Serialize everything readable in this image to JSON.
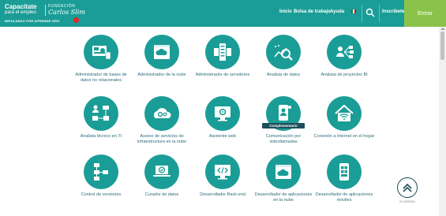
{
  "header": {
    "logo_line1": "Capacítate",
    "logo_line2": "para el empleo",
    "logo_fund_line1": "FUNDACIÓN",
    "logo_fund_line2": "Carlos Slim",
    "logo_sub": "IMPULSADO POR APRENDE.ORG",
    "nav": {
      "inicio": "Inicio",
      "bolsa": "Bolsa de trabajo",
      "ayuda": "Ayuda",
      "inscribete": "Inscríbete"
    },
    "entrar": "Entrar",
    "colors": {
      "bar": "#1a9d96",
      "entrar": "#8bc34a"
    }
  },
  "courses": [
    {
      "label": "Administrador de bases de datos no relacionales",
      "icon": "database-dashboard-icon"
    },
    {
      "label": "Administrador de la nube",
      "icon": "cloud-window-icon"
    },
    {
      "label": "Administrador de servidores",
      "icon": "server-icon"
    },
    {
      "label": "Analista de datos",
      "icon": "data-magnifier-icon"
    },
    {
      "label": "Analista de proyectos BI",
      "icon": "bi-network-icon"
    },
    {
      "label": "Analista técnico en TI",
      "icon": "flowchart-user-icon"
    },
    {
      "label": "Asesor de servicios de infraestructura en la nube",
      "icon": "cloud-gears-icon"
    },
    {
      "label": "Asistente web",
      "icon": "monitor-gear-icon"
    },
    {
      "label": "Comunicación por videollamadas",
      "icon": "video-call-icon",
      "badge": "Complementario"
    },
    {
      "label": "Conexión a internet en el hogar",
      "icon": "home-wifi-icon"
    },
    {
      "label": "Control de versiones",
      "icon": "version-tree-icon"
    },
    {
      "label": "Curador de datos",
      "icon": "laptop-check-icon"
    },
    {
      "label": "Desarrollador Back-end",
      "icon": "code-monitor-icon"
    },
    {
      "label": "Desarrollador de aplicaciones en la nube",
      "icon": "cloud-app-icon"
    },
    {
      "label": "Desarrollador de aplicaciones móviles",
      "icon": "mobile-app-icon"
    }
  ],
  "back_to_top": "IR ARRIBA"
}
